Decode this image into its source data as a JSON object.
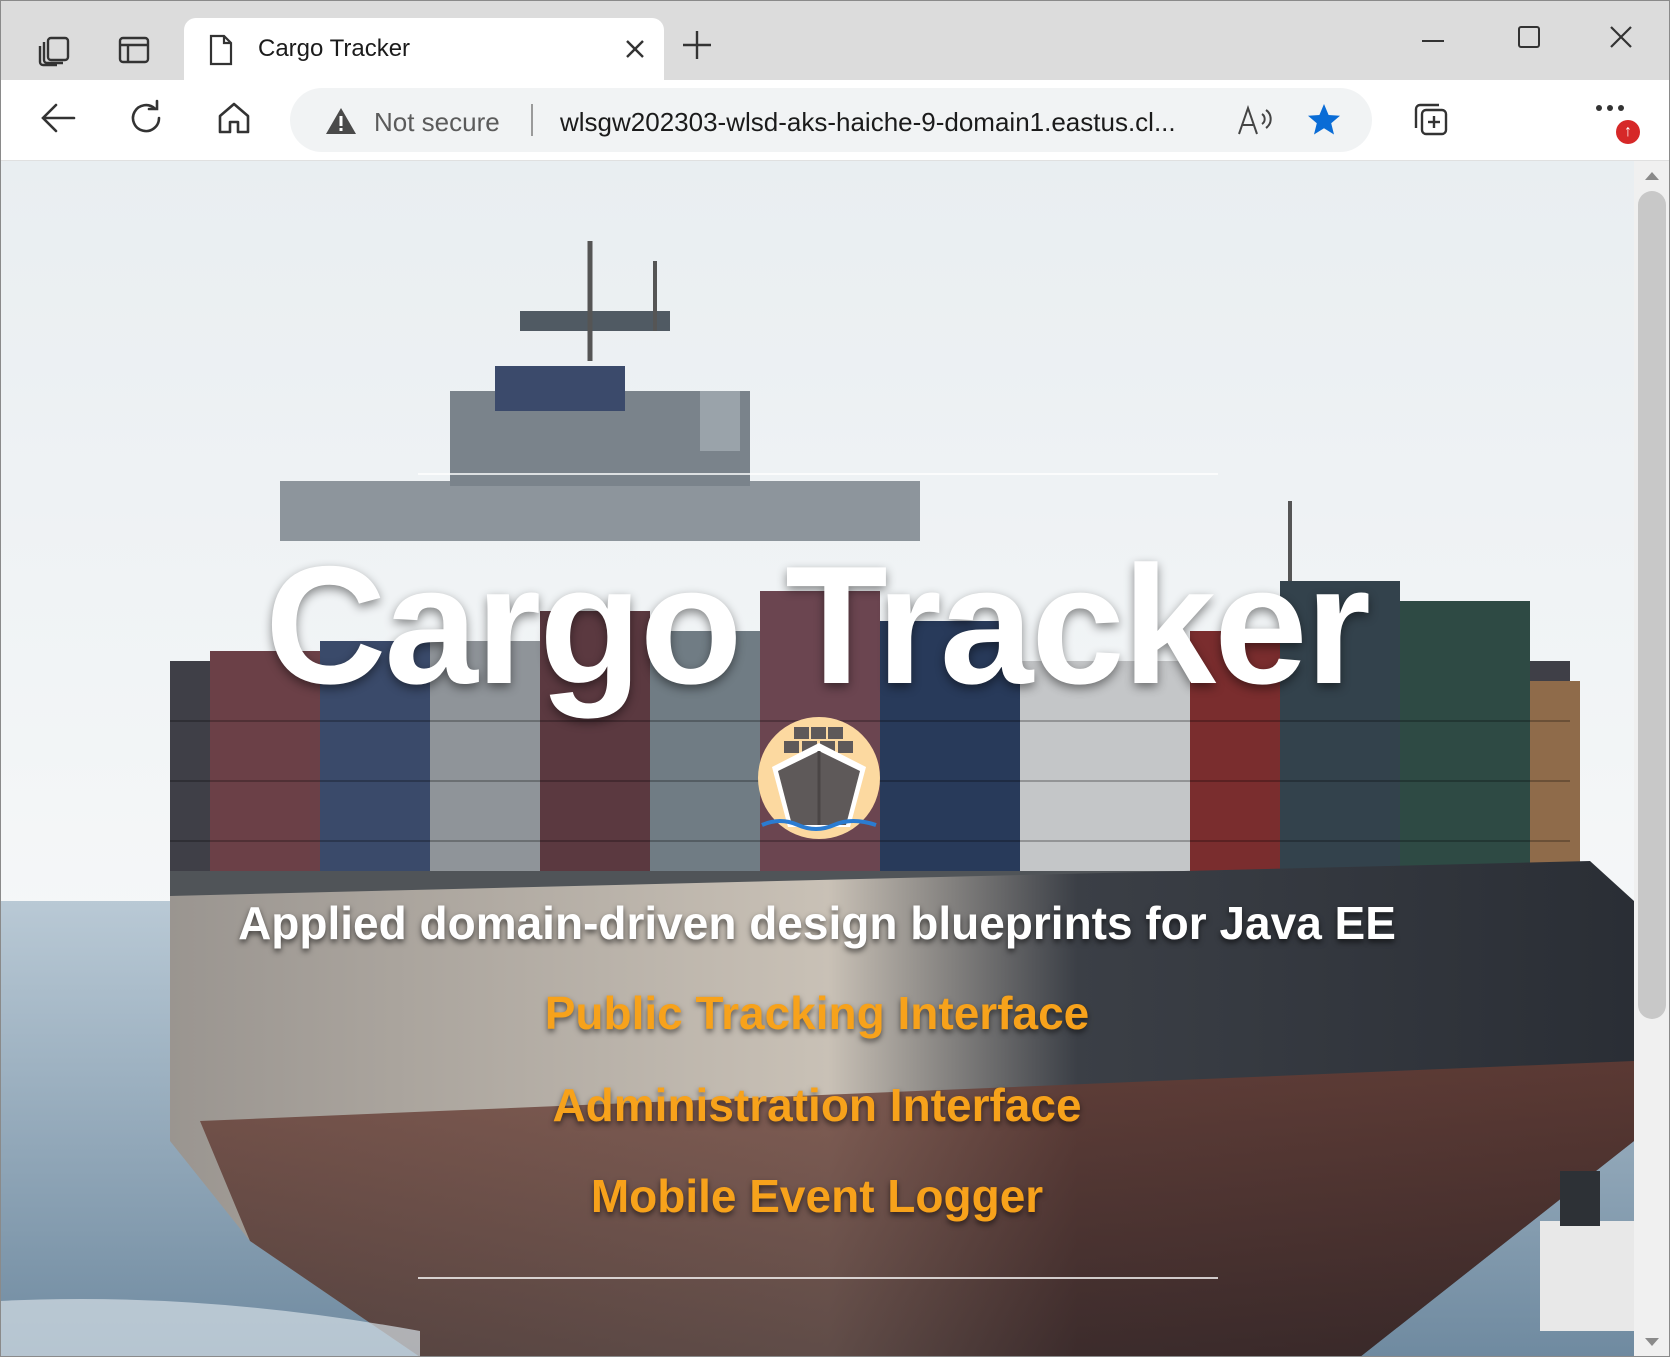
{
  "browser": {
    "tab": {
      "title": "Cargo Tracker"
    },
    "address_bar": {
      "security_label": "Not secure",
      "url": "wlsgw202303-wlsd-aks-haiche-9-domain1.eastus.cl..."
    },
    "icons": {
      "workspaces": "workspaces-icon",
      "tab_actions": "tab-actions-icon",
      "page": "page-icon",
      "close_tab": "close-icon",
      "new_tab": "plus-icon",
      "minimize": "minimize-icon",
      "maximize": "maximize-icon",
      "close_window": "close-icon",
      "back": "back-arrow-icon",
      "refresh": "refresh-icon",
      "home": "home-icon",
      "warning": "warning-icon",
      "read_aloud": "read-aloud-icon",
      "favorite": "star-icon",
      "collections": "collections-icon",
      "more": "more-icon",
      "update": "update-icon"
    },
    "accent_color": "#0a6cd6"
  },
  "page": {
    "title": "Cargo Tracker",
    "tagline": "Applied domain-driven design blueprints for Java EE",
    "links": [
      {
        "label": "Public Tracking Interface"
      },
      {
        "label": "Administration Interface"
      },
      {
        "label": "Mobile Event Logger"
      }
    ],
    "link_color": "#f7a21b",
    "logo": "cargo-ship-logo"
  }
}
